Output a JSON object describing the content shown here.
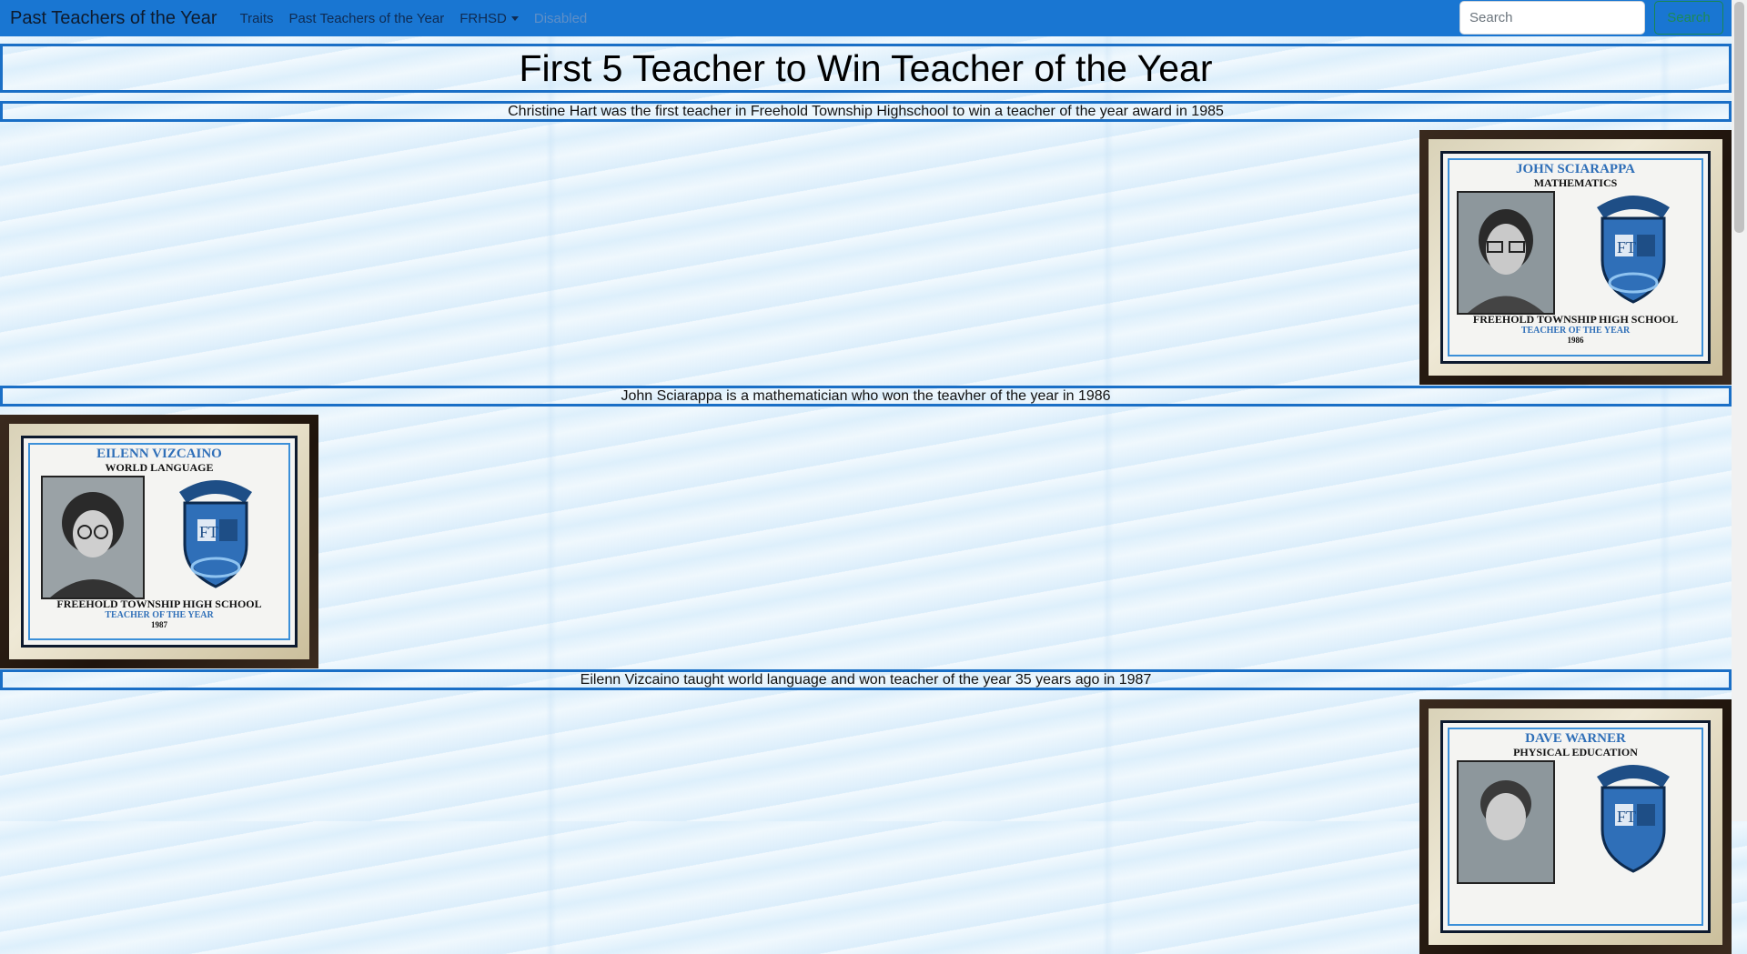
{
  "navbar": {
    "brand": "Past Teachers of the Year",
    "links": [
      "Traits",
      "Past Teachers of the Year",
      "FRHSD",
      "Disabled"
    ],
    "search_placeholder": "Search",
    "search_button": "Search"
  },
  "main": {
    "title": "First 5 Teacher to Win Teacher of the Year",
    "captions": [
      "Christine Hart was the first teacher in Freehold Township Highschool to win a teacher of the year award in 1985",
      "John Sciarappa is a mathematician who won the teavher of the year in 1986",
      "Eilenn Vizcaino taught world language and won teacher of the year 35 years ago in 1987"
    ]
  },
  "plaques": [
    {
      "name": "JOHN SCIARAPPA",
      "dept": "MATHEMATICS",
      "school": "FREEHOLD TOWNSHIP HIGH SCHOOL",
      "award": "TEACHER OF THE YEAR",
      "year": "1986"
    },
    {
      "name": "EILENN VIZCAINO",
      "dept": "WORLD LANGUAGE",
      "school": "FREEHOLD TOWNSHIP HIGH SCHOOL",
      "award": "TEACHER OF THE YEAR",
      "year": "1987"
    },
    {
      "name": "DAVE WARNER",
      "dept": "PHYSICAL EDUCATION",
      "school": "",
      "award": "",
      "year": ""
    }
  ],
  "colors": {
    "navbar": "#1976d2",
    "border": "#1a6fc6",
    "search_button": "#198754"
  }
}
